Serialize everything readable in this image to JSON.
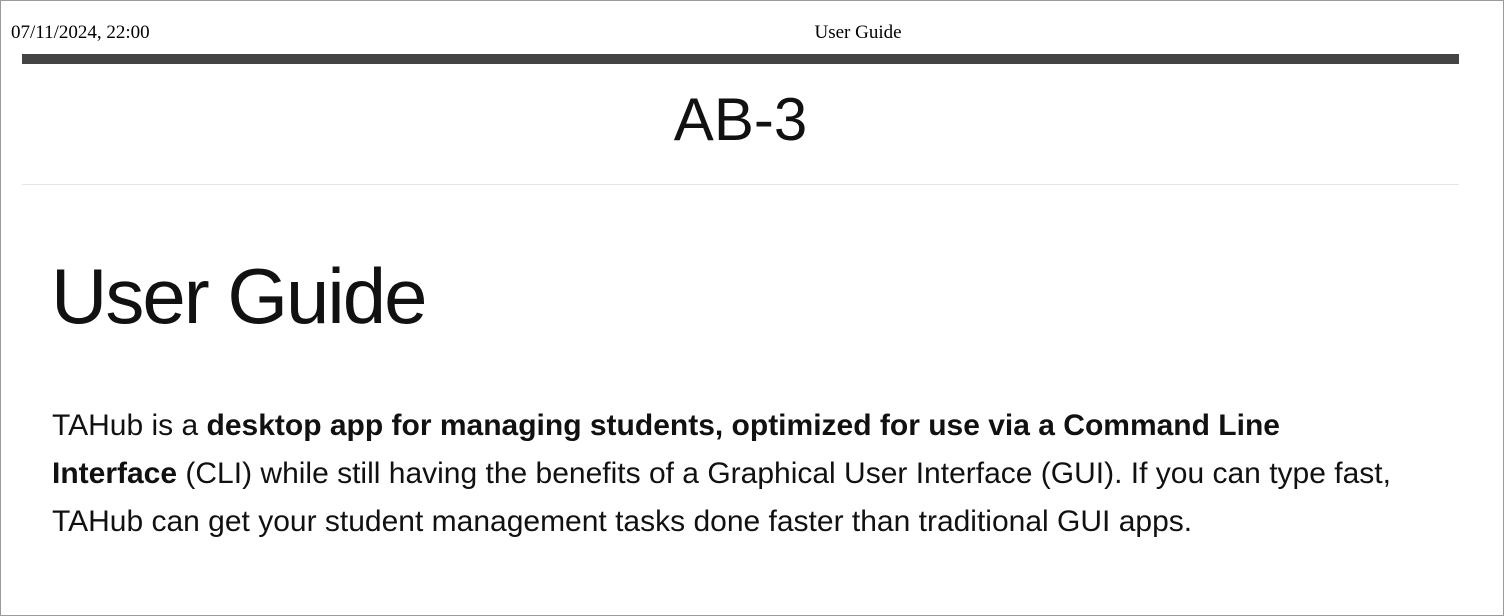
{
  "print_header": {
    "datetime": "07/11/2024, 22:00",
    "doc_title": "User Guide"
  },
  "site": {
    "title": "AB-3"
  },
  "page": {
    "heading": "User Guide",
    "intro": {
      "part1": "TAHub is a ",
      "bold1": "desktop app for managing students, optimized for use via a Command Line Interface",
      "part2": " (CLI) while still having the benefits of a Graphical User Interface (GUI). If you can type fast, TAHub can get your student management tasks done faster than traditional GUI apps."
    }
  },
  "colors": {
    "topbar": "#444444",
    "text": "#111111",
    "divider": "#e4e4e4"
  }
}
